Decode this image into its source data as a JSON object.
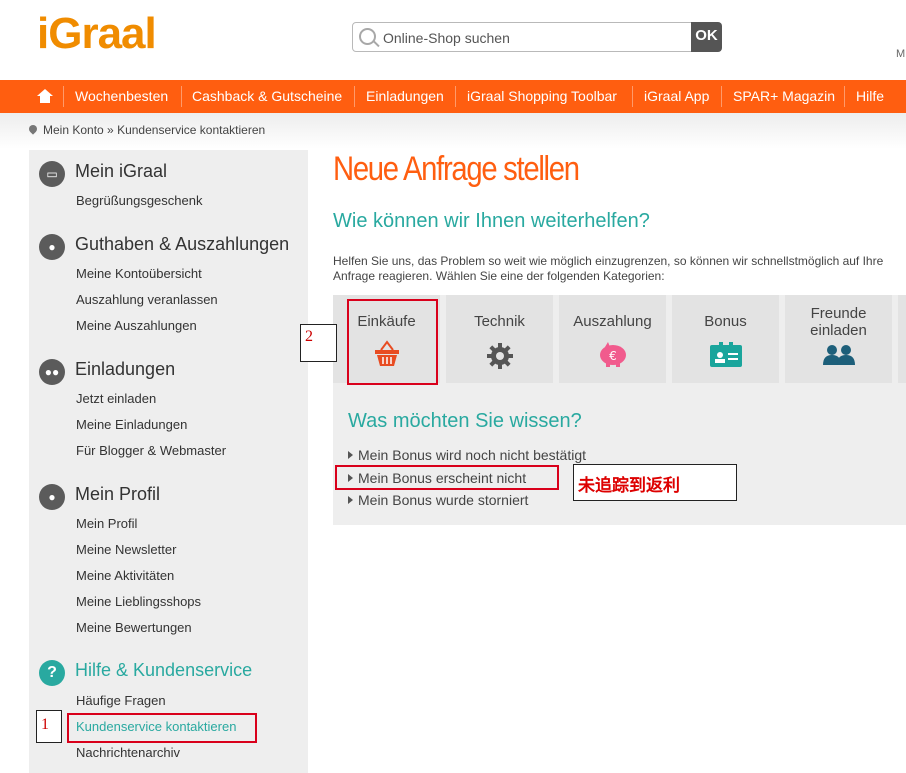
{
  "header": {
    "logo": "iGraal",
    "search_placeholder": "Online-Shop suchen",
    "search_button": "OK",
    "top_right": "M"
  },
  "nav": {
    "items": [
      "Wochenbesten",
      "Cashback & Gutscheine",
      "Einladungen",
      "iGraal Shopping Toolbar",
      "iGraal App",
      "SPAR+ Magazin",
      "Hilfe"
    ]
  },
  "breadcrumb": {
    "account": "Mein Konto",
    "sep": "»",
    "current": "Kundenservice kontaktieren"
  },
  "sidebar": {
    "sections": [
      {
        "title": "Mein iGraal",
        "icon": "id-card-icon",
        "links": [
          "Begrüßungsgeschenk"
        ]
      },
      {
        "title": "Guthaben & Auszahlungen",
        "icon": "piggy-bank-icon",
        "links": [
          "Meine Kontoübersicht",
          "Auszahlung veranlassen",
          "Meine Auszahlungen"
        ]
      },
      {
        "title": "Einladungen",
        "icon": "users-icon",
        "links": [
          "Jetzt einladen",
          "Meine Einladungen",
          "Für Blogger & Webmaster"
        ]
      },
      {
        "title": "Mein Profil",
        "icon": "user-icon",
        "links": [
          "Mein Profil",
          "Meine Newsletter",
          "Meine Aktivitäten",
          "Meine Lieblingsshops",
          "Meine Bewertungen"
        ]
      },
      {
        "title": "Hilfe & Kundenservice",
        "icon": "question-icon",
        "links": [
          "Häufige Fragen",
          "Kundenservice kontaktieren",
          "Nachrichtenarchiv"
        ]
      }
    ]
  },
  "main": {
    "title": "Neue Anfrage stellen",
    "subtitle": "Wie können wir Ihnen weiterhelfen?",
    "intro": "Helfen Sie uns, das Problem so weit wie möglich einzugrenzen, so können wir schnellstmöglich auf Ihre Anfrage reagieren. Wählen Sie eine der folgenden Kategorien:",
    "categories": [
      {
        "label": "Einkäufe",
        "icon": "basket-icon"
      },
      {
        "label": "Technik",
        "icon": "gear-icon"
      },
      {
        "label": "Auszahlung",
        "icon": "piggy-bank-euro-icon"
      },
      {
        "label": "Bonus",
        "icon": "bonus-card-icon"
      },
      {
        "label": "Freunde\neinladen",
        "icon": "users-icon"
      }
    ],
    "question_title": "Was möchten Sie wissen?",
    "questions": [
      "Mein Bonus wird noch nicht bestätigt",
      "Mein Bonus erscheint nicht",
      "Mein Bonus wurde storniert"
    ]
  },
  "annotations": {
    "step1": "1",
    "step2": "2",
    "note": "未追踪到返利"
  },
  "colors": {
    "brand_orange": "#ff5e10",
    "teal": "#29a9a0",
    "annotation_red": "#d9001b"
  }
}
